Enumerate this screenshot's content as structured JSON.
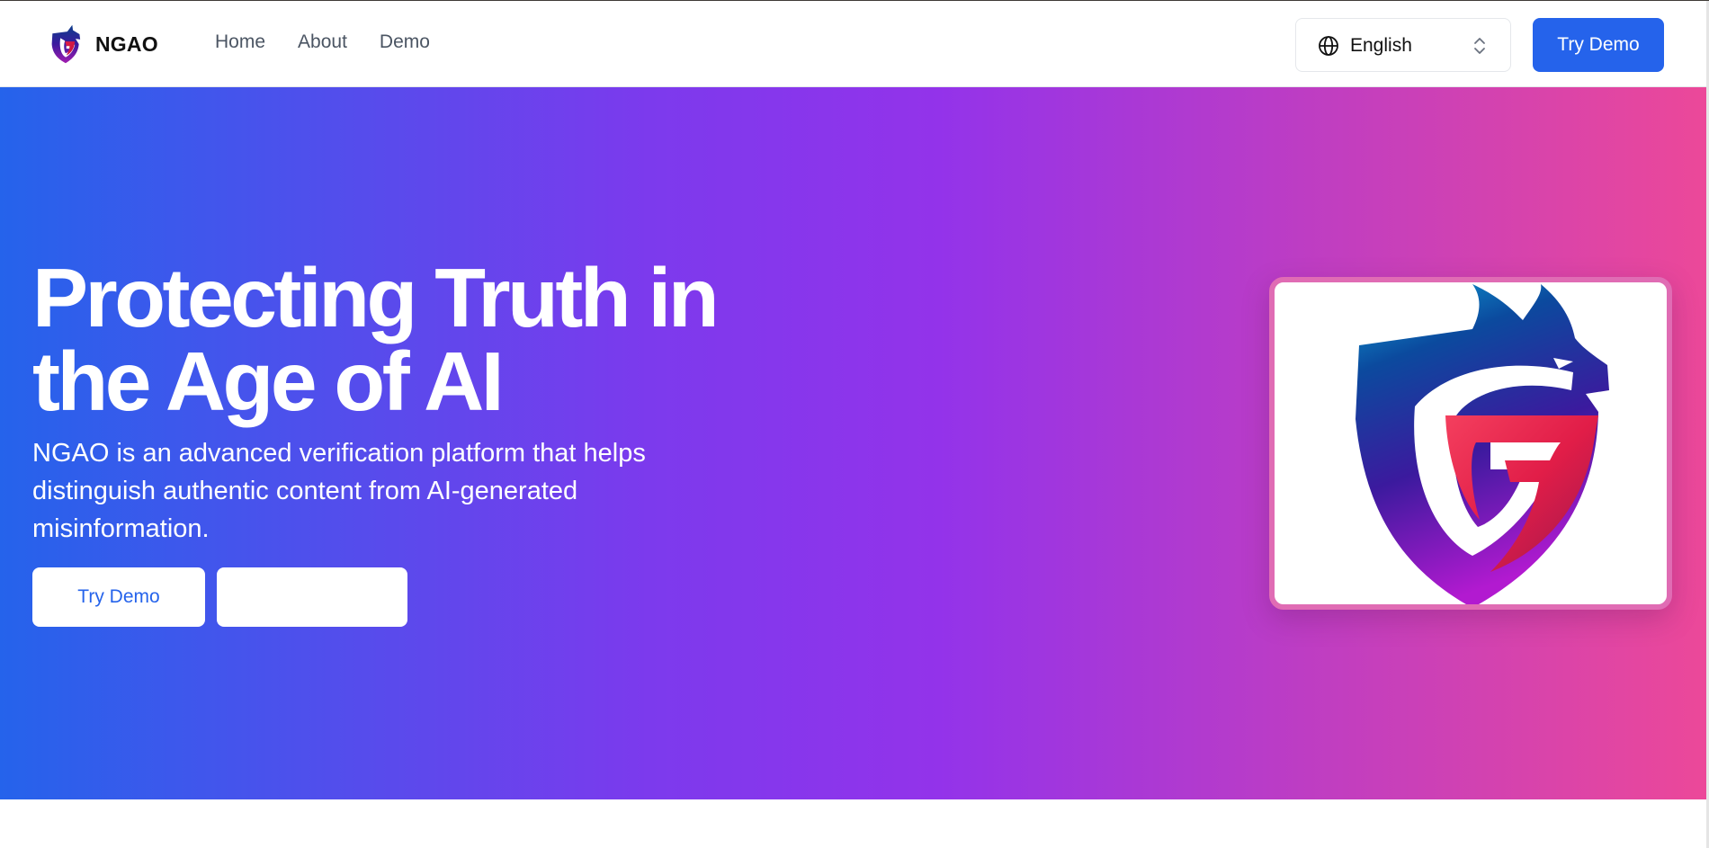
{
  "brand": {
    "name": "NGAO",
    "logo_icon": "ngao-dragon-shield-logo"
  },
  "nav": {
    "links": [
      {
        "label": "Home"
      },
      {
        "label": "About"
      },
      {
        "label": "Demo"
      }
    ],
    "language": {
      "selected": "English",
      "icon": "globe-icon",
      "chevron": "chevron-up-down-icon"
    },
    "cta_label": "Try Demo"
  },
  "hero": {
    "title": "Protecting Truth in the Age of AI",
    "subtitle": "NGAO is an advanced verification platform that helps distinguish authentic content from AI-generated misinformation.",
    "primary_button": "Try Demo",
    "secondary_button": "",
    "image_icon": "ngao-dragon-shield-logo"
  },
  "colors": {
    "primary": "#2563eb",
    "gradient_start": "#2563eb",
    "gradient_mid": "#9333ea",
    "gradient_end": "#ec4899",
    "frame_border": "#e06cb4"
  }
}
